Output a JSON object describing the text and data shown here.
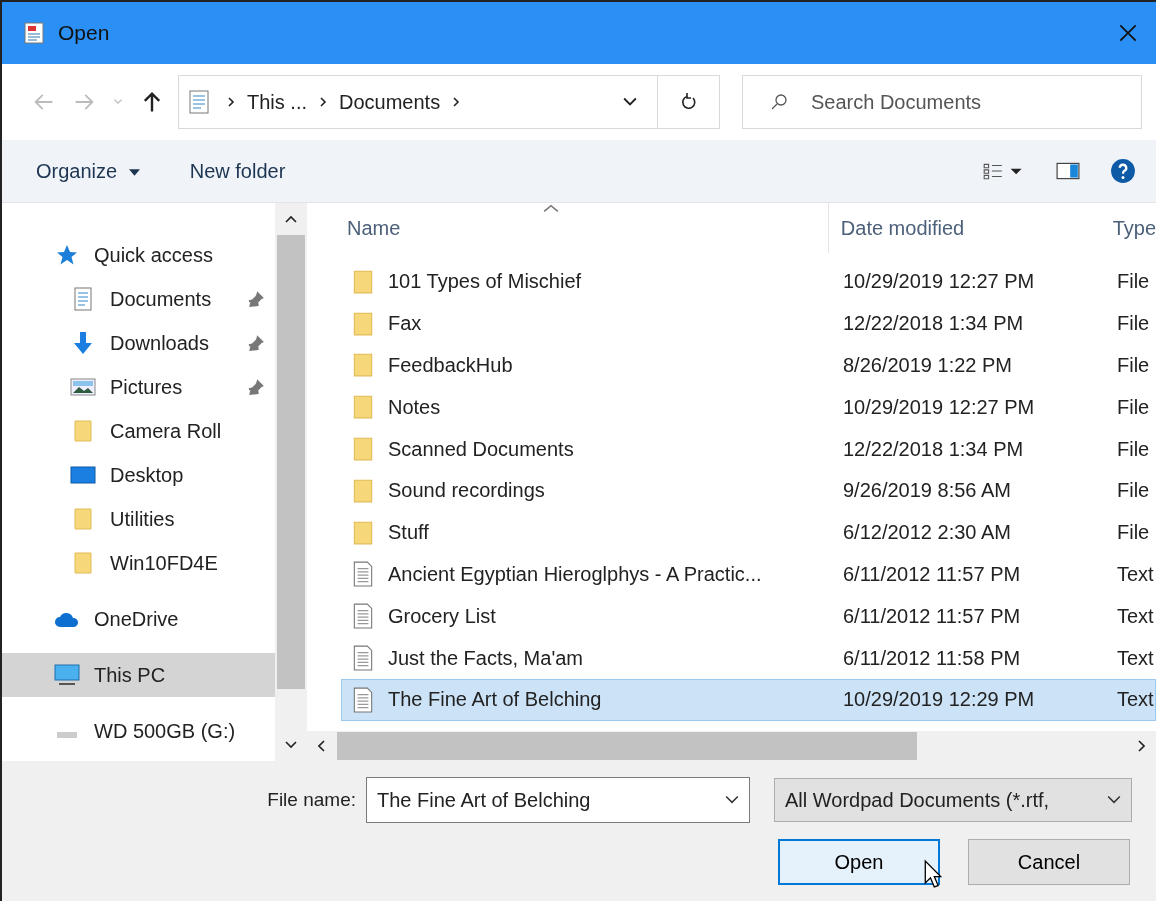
{
  "window": {
    "title": "Open"
  },
  "address": {
    "path": [
      "This ...",
      "Documents"
    ]
  },
  "search": {
    "placeholder": "Search Documents"
  },
  "toolbar": {
    "organize": "Organize",
    "new_folder": "New folder"
  },
  "sidebar": {
    "items": [
      {
        "label": "Quick access",
        "kind": "star",
        "selected": false,
        "children": [
          {
            "label": "Documents",
            "kind": "document",
            "pinned": true,
            "selected": false
          },
          {
            "label": "Downloads",
            "kind": "download",
            "pinned": true,
            "selected": false
          },
          {
            "label": "Pictures",
            "kind": "picture",
            "pinned": true,
            "selected": false
          },
          {
            "label": "Camera Roll",
            "kind": "folder",
            "pinned": false,
            "selected": false
          },
          {
            "label": "Desktop",
            "kind": "desktop",
            "pinned": false,
            "selected": false
          },
          {
            "label": "Utilities",
            "kind": "folder",
            "pinned": false,
            "selected": false
          },
          {
            "label": "Win10FD4E",
            "kind": "folder",
            "pinned": false,
            "selected": false
          }
        ]
      },
      {
        "label": "OneDrive",
        "kind": "cloud",
        "selected": false
      },
      {
        "label": "This PC",
        "kind": "pc",
        "selected": true
      },
      {
        "label": "WD 500GB (G:)",
        "kind": "drive",
        "selected": false
      }
    ]
  },
  "table": {
    "columns": [
      "Name",
      "Date modified",
      "Type"
    ],
    "rows": [
      {
        "name": "101 Types of Mischief",
        "date": "10/29/2019 12:27 PM",
        "type": "File",
        "kind": "folder",
        "selected": false
      },
      {
        "name": "Fax",
        "date": "12/22/2018 1:34 PM",
        "type": "File",
        "kind": "folder",
        "selected": false
      },
      {
        "name": "FeedbackHub",
        "date": "8/26/2019 1:22 PM",
        "type": "File",
        "kind": "folder",
        "selected": false
      },
      {
        "name": "Notes",
        "date": "10/29/2019 12:27 PM",
        "type": "File",
        "kind": "folder",
        "selected": false
      },
      {
        "name": "Scanned Documents",
        "date": "12/22/2018 1:34 PM",
        "type": "File",
        "kind": "folder",
        "selected": false
      },
      {
        "name": "Sound recordings",
        "date": "9/26/2019 8:56 AM",
        "type": "File",
        "kind": "folder",
        "selected": false
      },
      {
        "name": "Stuff",
        "date": "6/12/2012 2:30 AM",
        "type": "File",
        "kind": "folder",
        "selected": false
      },
      {
        "name": "Ancient Egyptian Hieroglphys - A Practic...",
        "date": "6/11/2012 11:57 PM",
        "type": "Text",
        "kind": "text",
        "selected": false
      },
      {
        "name": "Grocery List",
        "date": "6/11/2012 11:57 PM",
        "type": "Text",
        "kind": "text",
        "selected": false
      },
      {
        "name": "Just the Facts, Ma'am",
        "date": "6/11/2012 11:58 PM",
        "type": "Text",
        "kind": "text",
        "selected": false
      },
      {
        "name": "The Fine Art of Belching",
        "date": "10/29/2019 12:29 PM",
        "type": "Text",
        "kind": "text",
        "selected": true
      }
    ]
  },
  "footer": {
    "file_name_label": "File name:",
    "file_name": "The Fine Art of Belching",
    "file_type": "All Wordpad Documents (*.rtf,",
    "buttons": [
      {
        "label": "Open",
        "kind": "primary"
      },
      {
        "label": "Cancel",
        "kind": "normal"
      }
    ]
  }
}
